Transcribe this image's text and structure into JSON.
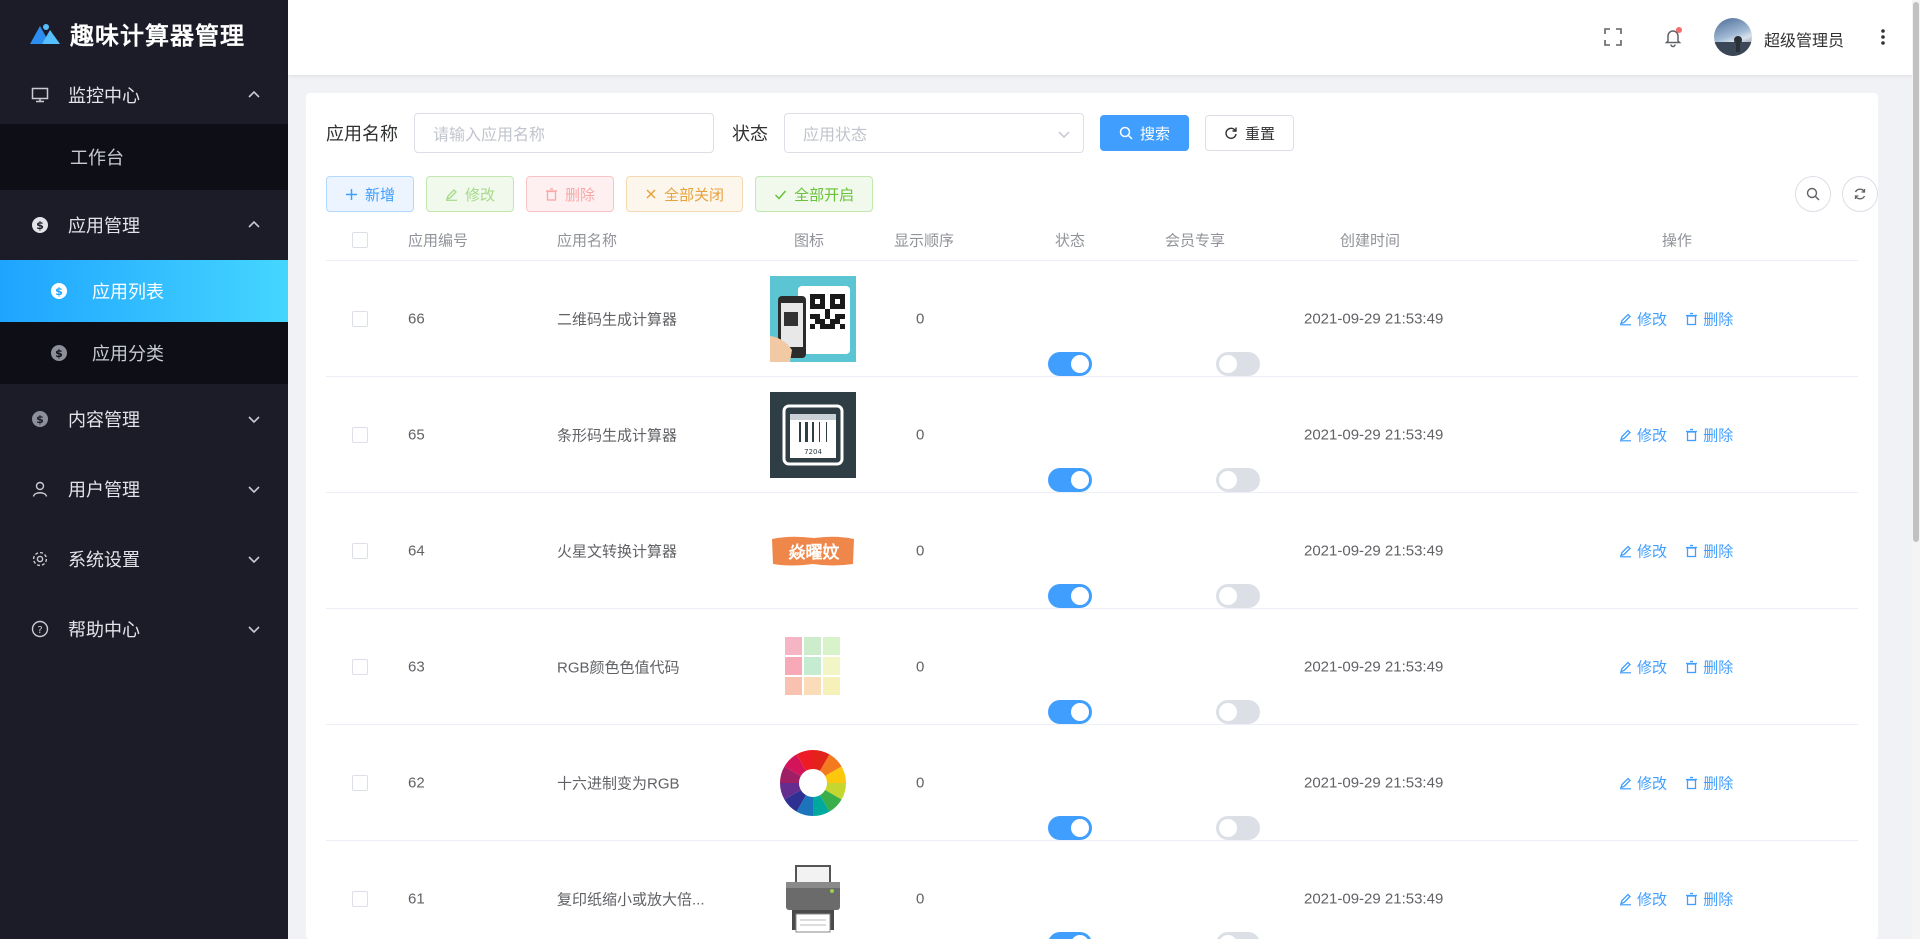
{
  "app": {
    "title": "趣味计算器管理"
  },
  "sidebar": {
    "groups": [
      {
        "label": "监控中心",
        "expanded": true,
        "items": [
          {
            "label": "工作台"
          }
        ]
      },
      {
        "label": "应用管理",
        "expanded": true,
        "items": [
          {
            "label": "应用列表",
            "active": true
          },
          {
            "label": "应用分类"
          }
        ]
      },
      {
        "label": "内容管理",
        "expanded": false
      },
      {
        "label": "用户管理",
        "expanded": false
      },
      {
        "label": "系统设置",
        "expanded": false
      },
      {
        "label": "帮助中心",
        "expanded": false
      }
    ]
  },
  "header": {
    "username": "超级管理员",
    "has_notification": true
  },
  "search": {
    "name_label": "应用名称",
    "name_placeholder": "请输入应用名称",
    "status_label": "状态",
    "status_placeholder": "应用状态",
    "search_button": "搜索",
    "reset_button": "重置"
  },
  "toolbar": {
    "add": "新增",
    "edit": "修改",
    "delete": "删除",
    "close_all": "全部关闭",
    "open_all": "全部开启"
  },
  "table": {
    "columns": [
      "应用编号",
      "应用名称",
      "图标",
      "显示顺序",
      "状态",
      "会员专享",
      "创建时间",
      "操作"
    ],
    "rows": [
      {
        "id": "66",
        "name": "二维码生成计算器",
        "icon": "qrcode-phone-icon",
        "order": "0",
        "status": true,
        "vip": false,
        "created": "2021-09-29 21:53:49",
        "edit": "修改",
        "delete": "删除"
      },
      {
        "id": "65",
        "name": "条形码生成计算器",
        "icon": "barcode-icon",
        "order": "0",
        "status": true,
        "vip": false,
        "created": "2021-09-29 21:53:49",
        "edit": "修改",
        "delete": "删除"
      },
      {
        "id": "64",
        "name": "火星文转换计算器",
        "icon": "martian-text-icon",
        "order": "0",
        "status": true,
        "vip": false,
        "created": "2021-09-29 21:53:49",
        "edit": "修改",
        "delete": "删除"
      },
      {
        "id": "63",
        "name": "RGB颜色色值代码",
        "icon": "color-swatch-icon",
        "order": "0",
        "status": true,
        "vip": false,
        "created": "2021-09-29 21:53:49",
        "edit": "修改",
        "delete": "删除"
      },
      {
        "id": "62",
        "name": "十六进制变为RGB",
        "icon": "color-wheel-icon",
        "order": "0",
        "status": true,
        "vip": false,
        "created": "2021-09-29 21:53:49",
        "edit": "修改",
        "delete": "删除"
      },
      {
        "id": "61",
        "name": "复印纸缩小或放大倍...",
        "icon": "printer-icon",
        "order": "0",
        "status": true,
        "vip": false,
        "created": "2021-09-29 21:53:49",
        "edit": "修改",
        "delete": "删除"
      }
    ]
  },
  "icon_images": {
    "martian_text": "焱曜妏"
  },
  "colors": {
    "primary": "#409eff",
    "sidebar_bg": "#1c1c28",
    "active_start": "#1ea4ff",
    "active_end": "#45d6ff"
  }
}
